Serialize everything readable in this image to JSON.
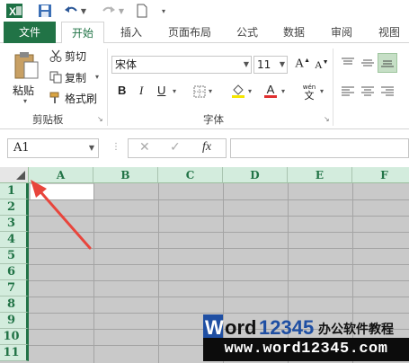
{
  "tabs": {
    "file": "文件",
    "items": [
      "开始",
      "插入",
      "页面布局",
      "公式",
      "数据",
      "审阅",
      "视图"
    ]
  },
  "clipboard": {
    "paste": "粘贴",
    "cut": "剪切",
    "copy": "复制",
    "format_painter": "格式刷",
    "group_label": "剪贴板"
  },
  "font": {
    "family": "宋体",
    "size": "11",
    "grow_icon_label": "A",
    "shrink_icon_label": "A",
    "bold": "B",
    "italic": "I",
    "underline": "U",
    "font_color_label": "A",
    "phonetic_label": "wén",
    "phonetic_char": "文",
    "group_label": "字体"
  },
  "formula_bar": {
    "name_box": "A1",
    "fx": "fx"
  },
  "grid": {
    "columns": [
      "A",
      "B",
      "C",
      "D",
      "E",
      "F"
    ],
    "rows": [
      "1",
      "2",
      "3",
      "4",
      "5",
      "6",
      "7",
      "8",
      "9",
      "10",
      "11"
    ]
  },
  "watermark": {
    "brand_prefix": "W",
    "brand_rest": "ord",
    "brand_number": "12345",
    "tagline": "办公软件教程",
    "url": "www.word12345.com"
  },
  "colors": {
    "accent": "#217346",
    "grid_fill": "#c9c9c9",
    "arrow": "#e8453c"
  }
}
